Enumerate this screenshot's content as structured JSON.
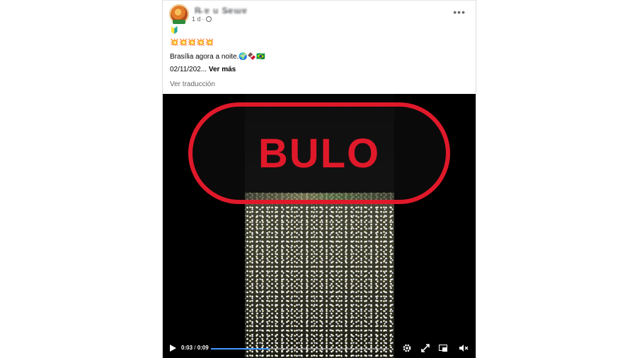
{
  "post": {
    "author_name": "R̶ ɐ u S̶ɐɯɐ",
    "time": "1 d",
    "more_label": "•••",
    "lines": [
      "🔰",
      "💥💥💥💥💥",
      "Brasília agora a noite.🌍🍫🇧🇷"
    ],
    "date_text": "02/11/202...",
    "see_more": "Ver más",
    "translate_label": "Ver traducción"
  },
  "video": {
    "stamp_text": "BULO",
    "time_current": "0:03",
    "time_separator": " / ",
    "time_total": "0:09",
    "progress": 0.33,
    "accent_color": "#4599ff",
    "stamp_color": "#e0192a",
    "icons": [
      "play-icon",
      "settings-gear-icon",
      "fullscreen-expand-icon",
      "picture-in-picture-icon",
      "volume-muted-icon"
    ]
  }
}
